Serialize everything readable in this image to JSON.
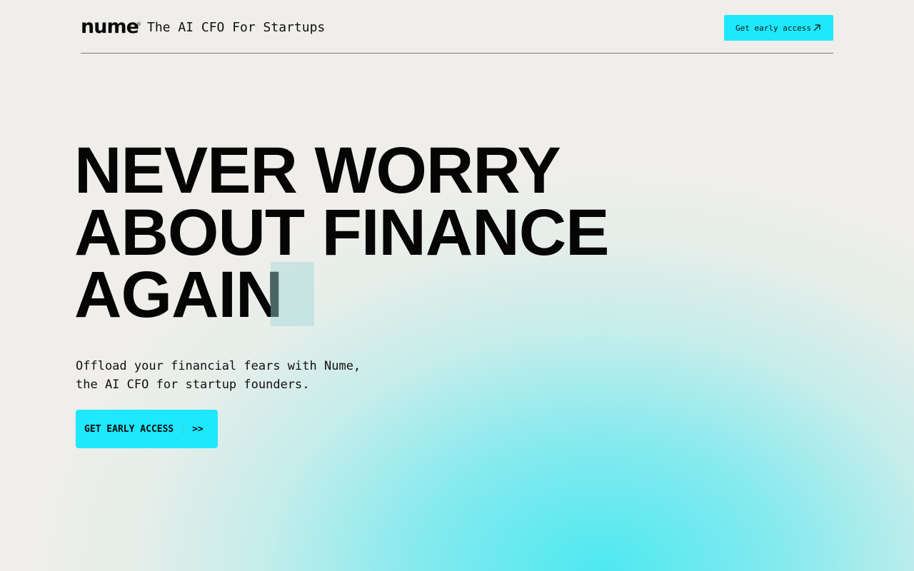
{
  "header": {
    "logo_text": "nume",
    "logo_mark": "®",
    "tagline": "The AI CFO For Startups",
    "cta_label": "Get early access",
    "cta_icon": "arrow-up-right-icon"
  },
  "hero": {
    "title_lines": [
      "NEVER WORRY",
      "ABOUT FINANCE",
      "AGAIN"
    ],
    "subtitle_lines": [
      "Offload your financial fears with Nume,",
      "the AI CFO for startup founders."
    ],
    "cta_label": "GET EARLY ACCESS",
    "cta_separator": "|",
    "cta_arrow": ">>"
  },
  "colors": {
    "accent": "#1ee8fc",
    "background": "#efeeea",
    "text": "#0a0a0a",
    "glow": "#40e8f2"
  }
}
